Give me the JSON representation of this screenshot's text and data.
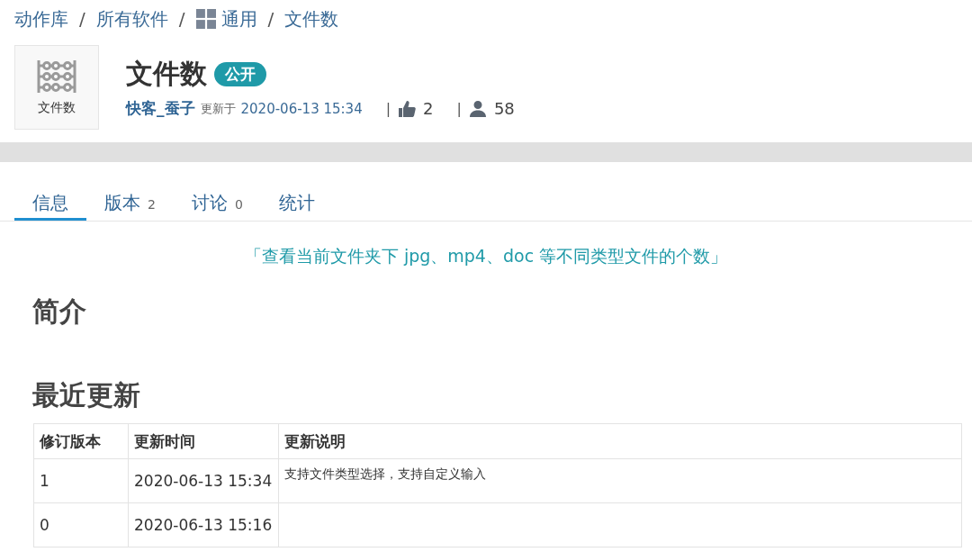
{
  "breadcrumb": [
    {
      "label": "动作库",
      "kind": "text"
    },
    {
      "separator": "/",
      "label": "所有软件",
      "kind": "text"
    },
    {
      "separator": "/",
      "label": "通用",
      "kind": "grid"
    },
    {
      "separator": "/",
      "label": "文件数",
      "kind": "text"
    }
  ],
  "app": {
    "icon_label": "文件数",
    "title": "文件数",
    "badge": "公开",
    "author": "快客_蚕子",
    "updated_label": "更新于",
    "updated": "2020-06-13 15:34",
    "separator_before_likes": "|",
    "likes": "2",
    "separator_before_users": "|",
    "users": "58"
  },
  "tabs": [
    {
      "label": "信息",
      "selected": true
    },
    {
      "label": "版本",
      "count": "2",
      "selected": false
    },
    {
      "label": "讨论",
      "count": "0",
      "selected": false
    },
    {
      "label": "统计",
      "selected": false
    }
  ],
  "tagline": "「查看当前文件夹下 jpg、mp4、doc 等不同类型文件的个数」",
  "sections": [
    "简介",
    "最近更新"
  ],
  "table": {
    "columns": [
      "修订版本",
      "更新时间",
      "更新说明"
    ],
    "rows": [
      [
        "1",
        "2020-06-13 15:34",
        "支持文件类型选择，支持自定义输入"
      ],
      [
        "0",
        "2020-06-13 15:16",
        ""
      ]
    ]
  }
}
